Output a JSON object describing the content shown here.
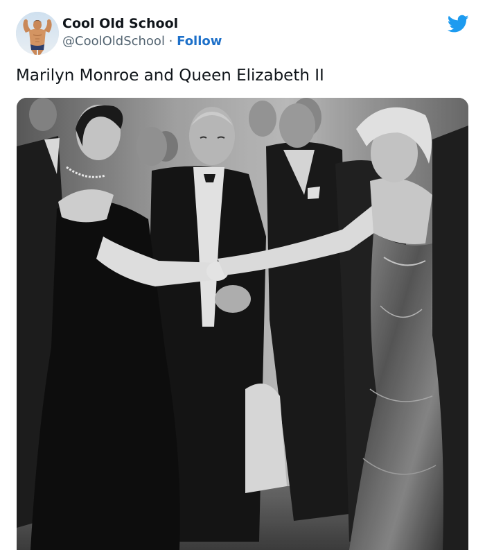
{
  "tweet": {
    "author": {
      "display_name": "Cool Old School",
      "handle": "@CoolOldSchool",
      "separator": " · ",
      "follow_label": "Follow",
      "avatar_icon": "bodybuilder-avatar"
    },
    "brand_icon": "twitter-bird-icon",
    "brand_color": "#1d9bf0",
    "follow_color": "#1d70c9",
    "text": "Marilyn Monroe and Queen Elizabeth II",
    "media": {
      "type": "photo",
      "style": "black-and-white"
    }
  }
}
